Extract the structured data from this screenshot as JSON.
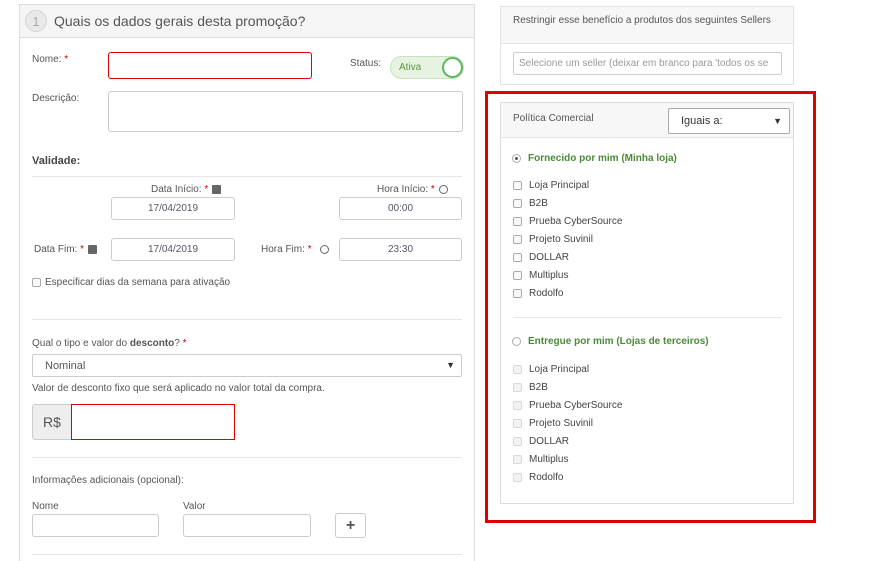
{
  "form": {
    "step_number": "1",
    "title": "Quais os dados gerais desta promoção?",
    "name_label": "Nome:",
    "required_mark": "*",
    "status_label": "Status:",
    "status_value": "Ativa",
    "description_label": "Descrição:",
    "validity_heading": "Validade:",
    "start_date_label": "Data Início:",
    "start_date": "17/04/2019",
    "start_time_label": "Hora Início:",
    "start_time": "00:00",
    "end_date_label": "Data Fim:",
    "end_date": "17/04/2019",
    "end_time_label": "Hora Fim:",
    "end_time": "23:30",
    "weekday_label": "Especificar dias da semana para ativação",
    "discount_label_prefix": "Qual o tipo e valor do ",
    "discount_label_bold": "desconto",
    "discount_label_suffix": "?",
    "discount_type": "Nominal",
    "discount_hint": "Valor de desconto fixo que será aplicado no valor total da compra.",
    "currency": "R$",
    "extra_info_label": "Informações adicionais (opcional):",
    "extra_name_label": "Nome",
    "extra_value_label": "Valor",
    "add_button": "+"
  },
  "sellers": {
    "title": "Restringir esse benefício a produtos dos seguintes Sellers",
    "placeholder": "Selecione um seller (deixar em branco para 'todos os se"
  },
  "policy": {
    "label": "Política Comercial",
    "selected": "Iguais a:",
    "group1": {
      "title": "Fornecido por mim (Minha loja)",
      "items": [
        "Loja Principal",
        "B2B",
        "Prueba CyberSource",
        "Projeto Suvinil",
        "DOLLAR",
        "Multiplus",
        "Rodolfo"
      ]
    },
    "group2": {
      "title": "Entregue por mim (Lojas de terceiros)",
      "items": [
        "Loja Principal",
        "B2B",
        "Prueba CyberSource",
        "Projeto Suvinil",
        "DOLLAR",
        "Multiplus",
        "Rodolfo"
      ]
    }
  },
  "icons": {
    "calendar": "calendar-icon",
    "clock": "clock-icon",
    "caret": "caret-down-icon"
  }
}
